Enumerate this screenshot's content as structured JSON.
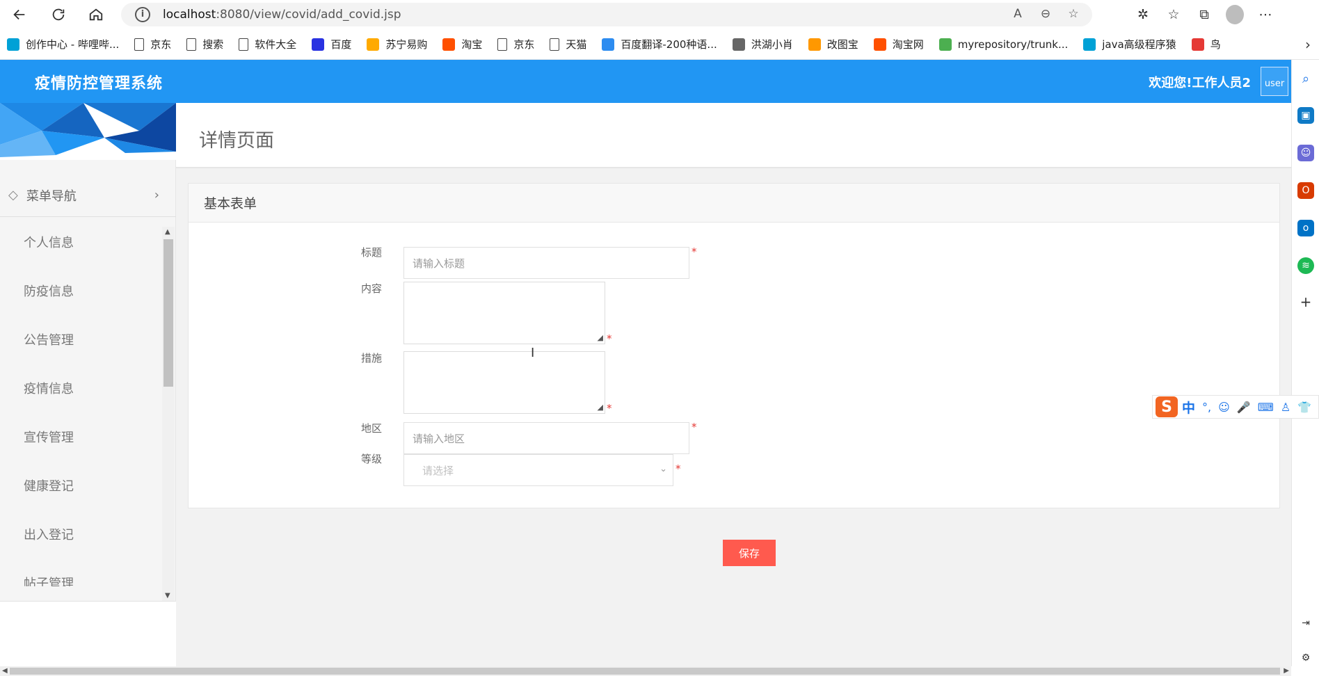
{
  "browser": {
    "url_host": "localhost",
    "url_path": ":8080/view/covid/add_covid.jsp",
    "bookmarks": [
      {
        "label": "创作中心 - 哔哩哔...",
        "icon": "bilibili-icon",
        "color": "#00a1d6"
      },
      {
        "label": "京东",
        "icon": "document-icon",
        "color": ""
      },
      {
        "label": "搜索",
        "icon": "document-icon",
        "color": ""
      },
      {
        "label": "软件大全",
        "icon": "document-icon",
        "color": ""
      },
      {
        "label": "百度",
        "icon": "baidu-paw-icon",
        "color": "#2932e1"
      },
      {
        "label": "苏宁易购",
        "icon": "suning-icon",
        "color": "#ffaa00"
      },
      {
        "label": "淘宝",
        "icon": "taobao-icon",
        "color": "#ff5000"
      },
      {
        "label": "京东",
        "icon": "document-icon",
        "color": ""
      },
      {
        "label": "天猫",
        "icon": "document-icon",
        "color": ""
      },
      {
        "label": "百度翻译-200种语...",
        "icon": "translate-icon",
        "color": "#2d8cf0"
      },
      {
        "label": "洪湖小肖",
        "icon": "bird-icon",
        "color": "#666666"
      },
      {
        "label": "改图宝",
        "icon": "gaitubao-icon",
        "color": "#ff9800"
      },
      {
        "label": "淘宝网",
        "icon": "taobao-icon",
        "color": "#ff5000"
      },
      {
        "label": "myrepository/trunk...",
        "icon": "chrome-icon",
        "color": "#4caf50"
      },
      {
        "label": "java高级程序猿",
        "icon": "bilibili-icon",
        "color": "#00a1d6"
      },
      {
        "label": "鸟",
        "icon": "bird-red-icon",
        "color": "#e53935"
      }
    ]
  },
  "app": {
    "title": "疫情防控管理系统",
    "welcome": "欢迎您!工作人员2",
    "user_alt": "user",
    "header_color": "#2196f3"
  },
  "sidebar": {
    "nav_label": "菜单导航",
    "items": [
      "个人信息",
      "防疫信息",
      "公告管理",
      "疫情信息",
      "宣传管理",
      "健康登记",
      "出入登记",
      "帖子管理"
    ]
  },
  "main": {
    "page_title": "详情页面",
    "card_title": "基本表单",
    "form": {
      "title_label": "标题",
      "title_placeholder": "请输入标题",
      "content_label": "内容",
      "measures_label": "措施",
      "region_label": "地区",
      "region_placeholder": "请输入地区",
      "level_label": "等级",
      "level_placeholder": "请选择",
      "required_mark": "*"
    },
    "save_label": "保存",
    "save_color": "#ff5a4e"
  },
  "ime": {
    "logo": "S",
    "mode": "中"
  }
}
